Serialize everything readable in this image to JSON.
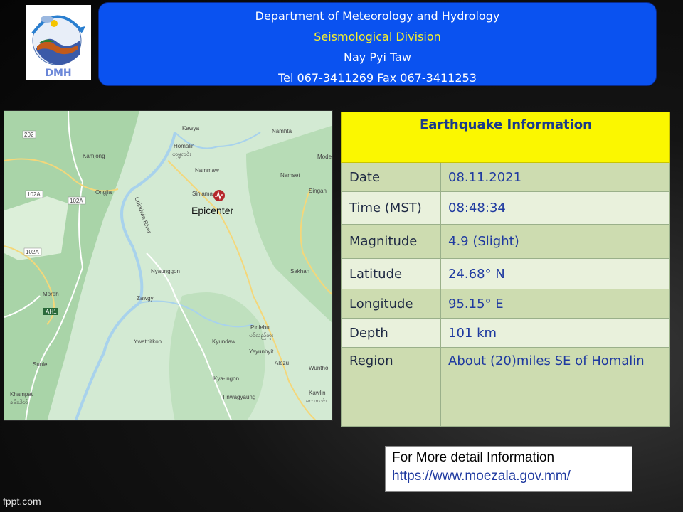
{
  "header": {
    "line1": "Department of Meteorology and Hydrology",
    "line2": "Seismological Division",
    "line3": "Nay Pyi Taw",
    "line4": "Tel 067-3411269 Fax 067-3411253"
  },
  "logo": {
    "text": "DMH"
  },
  "map": {
    "epicenter_label": "Epicenter",
    "places": {
      "kawya": "Kawya",
      "namhta": "Namhta",
      "homalin": "Homalin",
      "homalin_mm": "ဟုမ္မလင်း",
      "kamjong": "Kamjong",
      "mode": "Mode",
      "nammaw": "Nammaw",
      "namset": "Namset",
      "ongjia": "Ongjia",
      "singan": "Singan",
      "sinlamaw": "Sinlamaw",
      "chindwin": "Chindwin River",
      "nyaunggon": "Nyaunggon",
      "sakhan": "Sakhan",
      "moreh": "Moreh",
      "zawgyi": "Zawgyi",
      "pinlebu": "Pinlebu",
      "pinlebu_mm": "ပင်လည်ဘူး",
      "ywathitkon": "Ywathitkon",
      "kyundaw": "Kyundaw",
      "yeyunbyit": "Yeyunbyit",
      "sunle": "Sunle",
      "alezu": "Alezu",
      "wuntho": "Wuntho",
      "kya_ingon": "Kya-ingon",
      "khampat": "Khampat",
      "khampat_mm": "ခမ်းပါတ်",
      "kawlin": "Kawlin",
      "kawlin_mm": "ကောလင်း",
      "tinwagyaung": "Tinwagyaung"
    },
    "roads": {
      "r202": "202",
      "r102a_1": "102A",
      "r102a_2": "102A",
      "r102a_3": "102A",
      "ah1": "AH1"
    }
  },
  "info": {
    "title": "Earthquake Information",
    "rows": [
      {
        "label": "Date",
        "value": "08.11.2021"
      },
      {
        "label": "Time (MST)",
        "value": "08:48:34"
      },
      {
        "label": "Magnitude",
        "value": "4.9 (Slight)"
      },
      {
        "label": "Latitude",
        "value": "24.68° N"
      },
      {
        "label": "Longitude",
        "value": "95.15° E"
      },
      {
        "label": "Depth",
        "value": "101 km"
      },
      {
        "label": "Region",
        "value": "About (20)miles SE of Homalin"
      }
    ]
  },
  "more_info": {
    "line1": "For More detail Information",
    "line2": "https://www.moezala.gov.mm/"
  },
  "footer": {
    "watermark": "fppt.com"
  },
  "colors": {
    "header_bg": "#0a52f0",
    "title_bg": "#fbf700",
    "row_dark": "#cddcb0",
    "row_light": "#e9f1dc"
  }
}
